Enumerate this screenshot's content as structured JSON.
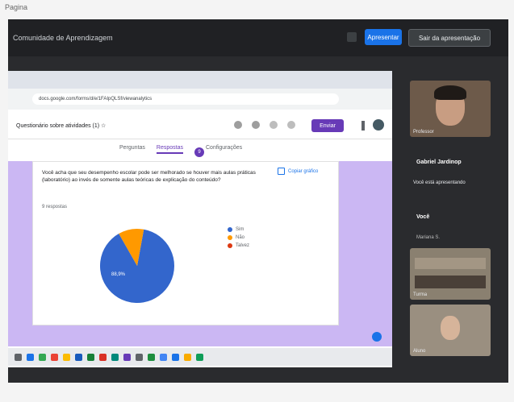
{
  "page": {
    "top_word": "Pagina"
  },
  "meet": {
    "title": "Comunidade de Aprendizagem",
    "present_button": "Apresentar",
    "stop_button": "Sair da apresentação"
  },
  "browser": {
    "url": "docs.google.com/forms/d/e/1FAIpQLSf/viewanalytics",
    "doc_title": "Questionário sobre atividades (1) ☆",
    "send_label": "Enviar"
  },
  "forms_tabs": [
    {
      "label": "Perguntas"
    },
    {
      "label": "Respostas"
    },
    {
      "label": "Configurações"
    }
  ],
  "responses_badge": "9",
  "question": {
    "text": "Você acha que seu desempenho escolar pode ser melhorado se houver mais aulas práticas (laboratório) ao invés de somente aulas teóricas de explicação do conteúdo?",
    "count": "9 respostas",
    "copy_link": "Copiar gráfico"
  },
  "chart_data": {
    "type": "pie",
    "categories": [
      "Sim",
      "Não",
      "Talvez"
    ],
    "values": [
      88.9,
      11.1,
      0
    ],
    "slice_label": "88,9%",
    "colors": [
      "#3366cc",
      "#ff9900",
      "#dc3912"
    ]
  },
  "participants": [
    {
      "name": "Professor",
      "role": "video"
    },
    {
      "name": "Gabriel Jardinop",
      "subtitle": "Você está apresentando",
      "role": "info"
    },
    {
      "name": "Você",
      "subtitle": "Mariana S.",
      "role": "info"
    },
    {
      "name": "Turma",
      "role": "video"
    },
    {
      "name": "Aluno",
      "role": "video"
    }
  ],
  "colors": {
    "meet_dark": "#202124",
    "accent_blue": "#1a73e8",
    "forms_purple": "#673ab7",
    "lavender": "#cbb7f3"
  },
  "taskbar_icons": [
    "search-icon",
    "file-icon",
    "chrome-icon",
    "mail-icon",
    "folder-icon",
    "word-icon",
    "excel-icon",
    "ppt-icon",
    "meet-icon",
    "forms-icon",
    "settings-icon",
    "photos-icon",
    "store-icon",
    "calendar-icon",
    "notes-icon",
    "drive-icon"
  ]
}
